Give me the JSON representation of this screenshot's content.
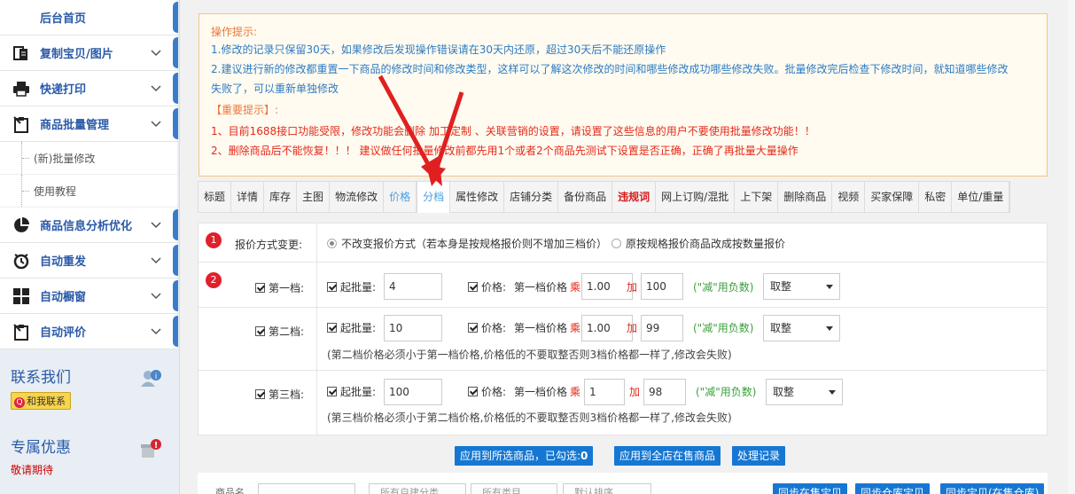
{
  "sidebar": {
    "home": "后台首页",
    "items": [
      {
        "label": "复制宝贝/图片",
        "icon": "copy-icon"
      },
      {
        "label": "快递打印",
        "icon": "printer-icon"
      },
      {
        "label": "商品批量管理",
        "icon": "clipboard-icon"
      },
      {
        "label": "商品信息分析优化",
        "icon": "pie-chart-icon"
      },
      {
        "label": "自动重发",
        "icon": "clock-icon"
      },
      {
        "label": "自动橱窗",
        "icon": "grid-icon"
      },
      {
        "label": "自动评价",
        "icon": "clipboard-icon"
      }
    ],
    "subitems": [
      "(新)批量修改",
      "使用教程"
    ],
    "contact_title": "联系我们",
    "contact_btn": "和我联系",
    "promo_title": "专属优惠",
    "promo_sub": "敬请期待"
  },
  "notice": {
    "title": "操作提示:",
    "line1": "1.修改的记录只保留30天，如果修改后发现操作错误请在30天内还原，超过30天后不能还原操作",
    "line2": "2.建议进行新的修改都重置一下商品的修改时间和修改类型，这样可以了解这次修改的时间和哪些修改成功哪些修改失败。批量修改完后检查下修改时间，就知道哪些修改",
    "line2b": "失败了，可以重新单独修改",
    "important": "【重要提示】:",
    "r1": "1、目前1688接口功能受限，修改功能会删除 加工定制 、关联营销的设置，请设置了这些信息的用户不要使用批量修改功能！！",
    "r2": "2、删除商品后不能恢复！！！ 建议做任何批量修改前都先用1个或者2个商品先测试下设置是否正确，正确了再批量大量操作"
  },
  "tabs": [
    "标题",
    "详情",
    "库存",
    "主图",
    "物流修改",
    "价格",
    "分档",
    "属性修改",
    "店铺分类",
    "备份商品",
    "违规词",
    "网上订购/混批",
    "上下架",
    "删除商品",
    "视频",
    "买家保障",
    "私密",
    "单位/重量"
  ],
  "form": {
    "badge1": "1",
    "badge2": "2",
    "price_method_label": "报价方式变更:",
    "opt1": "不改变报价方式（若本身是按规格报价则不增加三档价）",
    "opt2": "原按规格报价商品改成按数量报价",
    "tiers": [
      {
        "label": "第一档:",
        "min_label": "起批量:",
        "min": "4",
        "price_label": "价格:",
        "base": "第一档价格",
        "mul_label": "乘",
        "mul": "1.00",
        "add_label": "加",
        "add": "100",
        "hint": "(\"减\"用负数)",
        "round": "取整",
        "note": ""
      },
      {
        "label": "第二档:",
        "min_label": "起批量:",
        "min": "10",
        "price_label": "价格:",
        "base": "第一档价格",
        "mul_label": "乘",
        "mul": "1.00",
        "add_label": "加",
        "add": "99",
        "hint": "(\"减\"用负数)",
        "round": "取整",
        "note": "(第二档价格必须小于第一档价格,价格低的不要取整否则3档价格都一样了,修改会失败)"
      },
      {
        "label": "第三档:",
        "min_label": "起批量:",
        "min": "100",
        "price_label": "价格:",
        "base": "第一档价格",
        "mul_label": "乘",
        "mul": "1",
        "add_label": "加",
        "add": "98",
        "hint": "(\"减\"用负数)",
        "round": "取整",
        "note": "(第三档价格必须小于第二档价格,价格低的不要取整否则3档价格都一样了,修改会失败)"
      }
    ]
  },
  "buttons": {
    "apply_selected": "应用到所选商品，已勾选:",
    "selected_count": "0",
    "apply_all": "应用到全店在售商品",
    "records": "处理记录"
  },
  "filter": {
    "product_label": "商品名",
    "cat1": "所有自建分类",
    "cat2": "所有类目",
    "sort": "默认排序",
    "sync1": "同步在售宝贝",
    "sync2": "同步仓库宝贝",
    "sync3": "同步宝贝(在售仓库)"
  }
}
